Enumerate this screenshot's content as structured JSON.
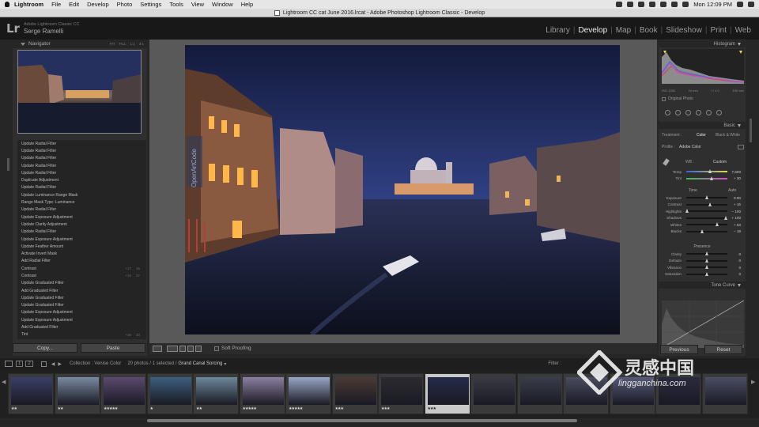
{
  "menubar": {
    "items": [
      "Lightroom",
      "File",
      "Edit",
      "Develop",
      "Photo",
      "Settings",
      "Tools",
      "View",
      "Window",
      "Help"
    ],
    "clock": "Mon 12:09 PM"
  },
  "window": {
    "title": "Lightroom CC cat June 2016.lrcat - Adobe Photoshop Lightroom Classic - Develop"
  },
  "identity": {
    "logo": "Lr",
    "catalog_name": "Adobe Lightroom Classic CC",
    "user": "Serge Ramelli"
  },
  "modules": {
    "items": [
      "Library",
      "Develop",
      "Map",
      "Book",
      "Slideshow",
      "Print",
      "Web"
    ],
    "active": "Develop"
  },
  "navigator": {
    "title": "Navigator",
    "zoom_options": [
      "FIT",
      "FILL",
      "1:1",
      "3:1"
    ]
  },
  "history": {
    "items": [
      {
        "label": "Update Radial Filter"
      },
      {
        "label": "Update Radial Filter"
      },
      {
        "label": "Update Radial Filter"
      },
      {
        "label": "Update Radial Filter"
      },
      {
        "label": "Update Radial Filter"
      },
      {
        "label": "Duplicate Adjustment"
      },
      {
        "label": "Update Radial Filter"
      },
      {
        "label": "Update Luminance Range Mask"
      },
      {
        "label": "Range Mask Type: Luminance"
      },
      {
        "label": "Update Radial Filter"
      },
      {
        "label": "Update Exposure Adjustment"
      },
      {
        "label": "Update Clarity Adjustment"
      },
      {
        "label": "Update Radial Filter"
      },
      {
        "label": "Update Exposure Adjustment"
      },
      {
        "label": "Update Feather Amount"
      },
      {
        "label": "Activate Invert Mask"
      },
      {
        "label": "Add Radial Filter"
      },
      {
        "label": "Contrast",
        "n1": "+17",
        "n2": "16"
      },
      {
        "label": "Contrast",
        "n1": "+16",
        "n2": "27"
      },
      {
        "label": "Update Graduated Filter"
      },
      {
        "label": "Add Graduated Filter"
      },
      {
        "label": "Update Graduated Filter"
      },
      {
        "label": "Update Graduated Filter"
      },
      {
        "label": "Update Exposure Adjustment"
      },
      {
        "label": "Update Exposure Adjustment"
      },
      {
        "label": "Add Graduated Filter"
      },
      {
        "label": "Tint",
        "n1": "+30",
        "n2": "30"
      }
    ],
    "copy_button": "Copy...",
    "paste_button": "Paste"
  },
  "toolbar": {
    "soft_proofing": "Soft Proofing"
  },
  "histogram": {
    "title": "Histogram",
    "meta": [
      "ISO 1250",
      "24 mm",
      "f / 4.0",
      "1⁄30 sec"
    ],
    "original_photo": "Original Photo"
  },
  "basic": {
    "title": "Basic",
    "treatment_label": "Treatment :",
    "treatment_color": "Color",
    "treatment_bw": "Black & White",
    "profile_label": "Profile :",
    "profile_value": "Adobe Color",
    "wb_label": "WB :",
    "wb_value": "Custom",
    "tone_label": "Tone",
    "tone_auto": "Auto",
    "presence_label": "Presence",
    "sliders_wb": [
      {
        "label": "Temp",
        "value": "7,500",
        "frac": 0.58
      },
      {
        "label": "Tint",
        "value": "+ 30",
        "frac": 0.62
      }
    ],
    "sliders_tone": [
      {
        "label": "Exposure",
        "value": "0.00",
        "frac": 0.5
      },
      {
        "label": "Contrast",
        "value": "+ 16",
        "frac": 0.58
      },
      {
        "label": "Highlights",
        "value": "− 100",
        "frac": 0.02
      },
      {
        "label": "Shadows",
        "value": "+ 100",
        "frac": 0.98
      },
      {
        "label": "Whites",
        "value": "+ 53",
        "frac": 0.76
      },
      {
        "label": "Blacks",
        "value": "− 19",
        "frac": 0.4
      }
    ],
    "sliders_presence": [
      {
        "label": "Clarity",
        "value": "0",
        "frac": 0.5
      },
      {
        "label": "Dehaze",
        "value": "0",
        "frac": 0.5
      },
      {
        "label": "Vibrance",
        "value": "0",
        "frac": 0.5
      },
      {
        "label": "Saturation",
        "value": "0",
        "frac": 0.5
      }
    ]
  },
  "tone_curve": {
    "title": "Tone Curve"
  },
  "right_buttons": {
    "previous": "Previous",
    "reset": "Reset"
  },
  "filmstrip_bar": {
    "page_buttons": [
      "1",
      "2"
    ],
    "collection": "Collection : Venise Color",
    "count": "20 photos / 1 selected /",
    "filename": "Grand Canal Sorcing",
    "filter_label": "Filter :"
  },
  "filmstrip": {
    "thumbs": [
      {
        "stars": "★★",
        "selected": false,
        "tone": "#3a3f66"
      },
      {
        "stars": "★★",
        "selected": false,
        "tone": "#7a8aa0"
      },
      {
        "stars": "★★★★★",
        "selected": false,
        "tone": "#5b4a70"
      },
      {
        "stars": "★",
        "selected": false,
        "tone": "#3d5f7c"
      },
      {
        "stars": "★★",
        "selected": false,
        "tone": "#6d879a"
      },
      {
        "stars": "★★★★★",
        "selected": false,
        "tone": "#8c7fa0"
      },
      {
        "stars": "★★★★★",
        "selected": false,
        "tone": "#9aa6c6"
      },
      {
        "stars": "★★★",
        "selected": false,
        "tone": "#4a3a35"
      },
      {
        "stars": "★★★",
        "selected": false,
        "tone": "#2c2b30"
      },
      {
        "stars": "★★★",
        "selected": true,
        "tone": "#262a4a"
      },
      {
        "stars": "",
        "selected": false,
        "tone": "#3a3a44"
      },
      {
        "stars": "",
        "selected": false,
        "tone": "#3a3e4a"
      },
      {
        "stars": "",
        "selected": false,
        "tone": "#4a4c60"
      },
      {
        "stars": "",
        "selected": false,
        "tone": "#565a78"
      },
      {
        "stars": "",
        "selected": false,
        "tone": "#2a2a3e"
      },
      {
        "stars": "",
        "selected": false,
        "tone": "#4a4f66"
      }
    ]
  },
  "watermark": {
    "line1": "灵感中国",
    "line2": "lingganchina.com"
  },
  "image_watermark": "OpenArtCode"
}
